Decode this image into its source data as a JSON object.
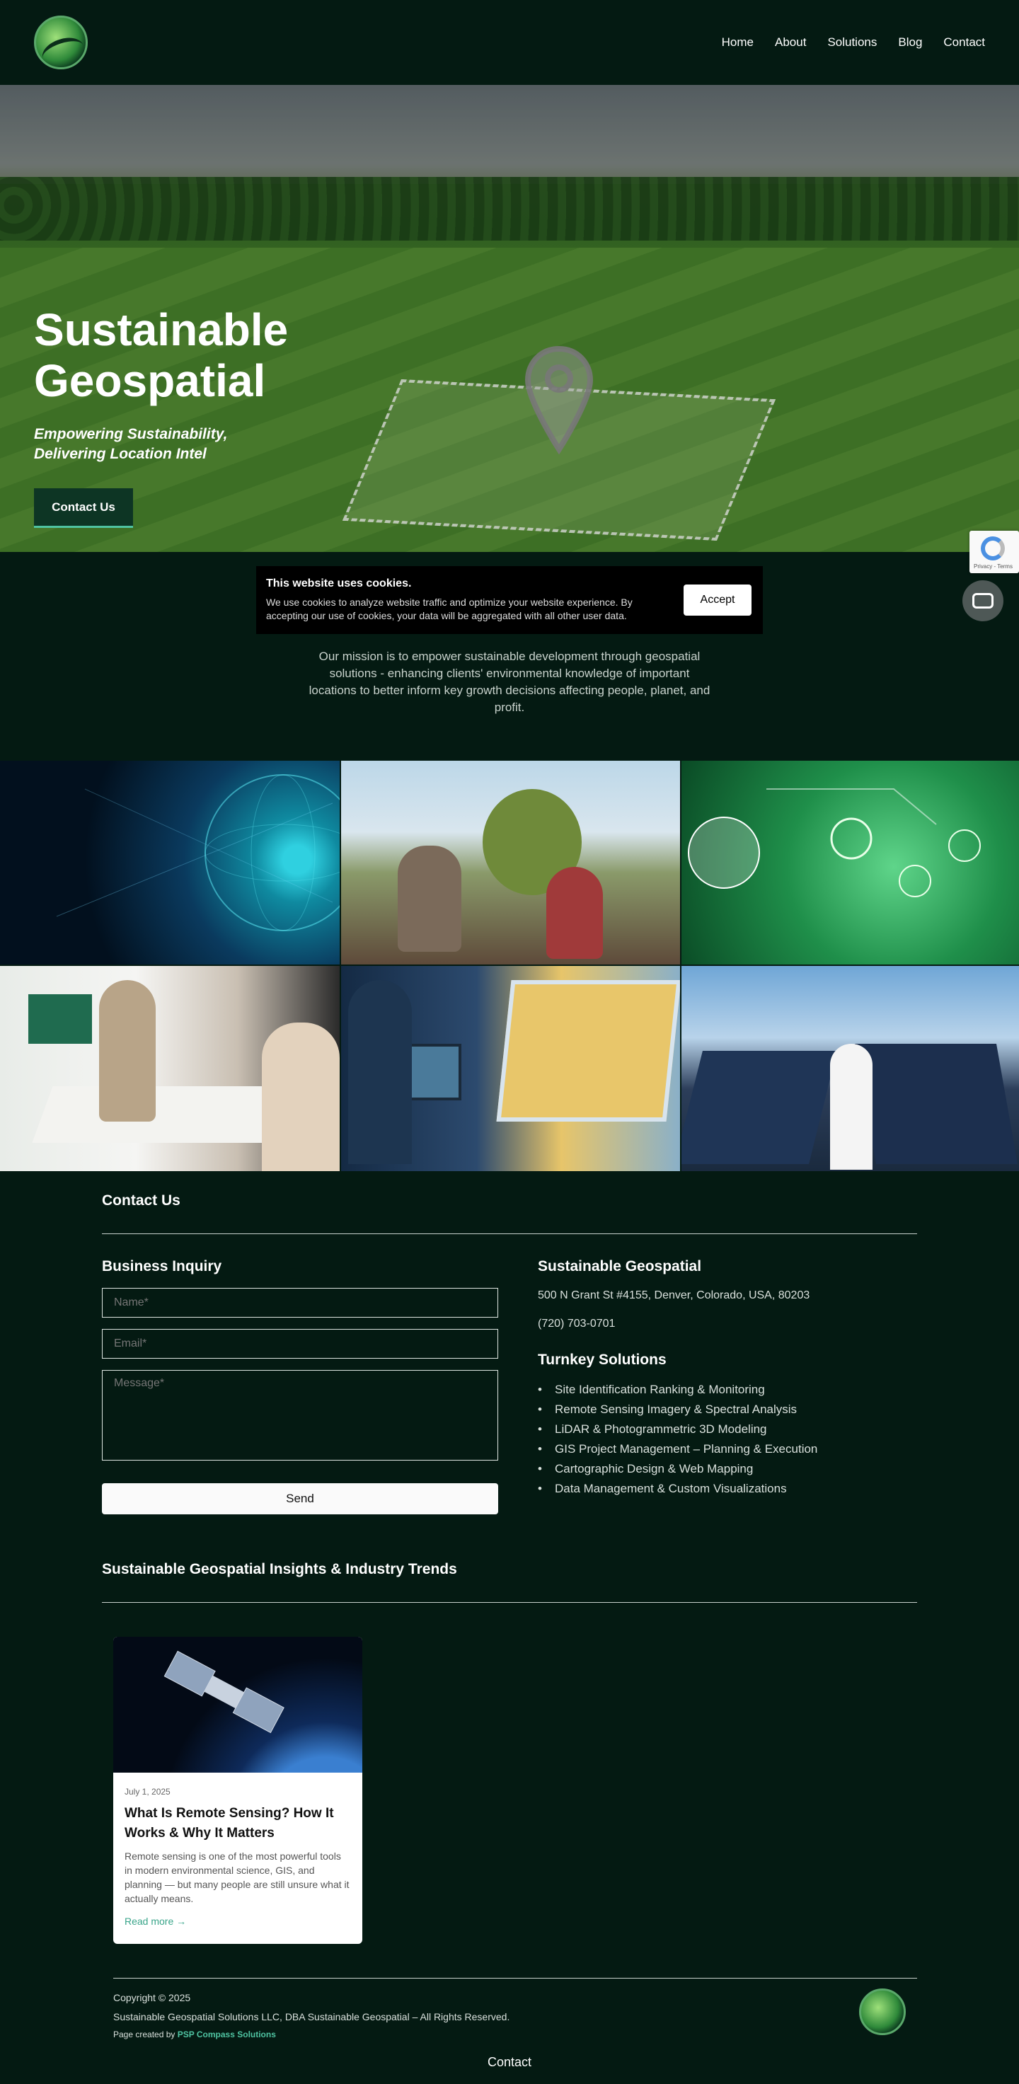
{
  "header": {
    "nav": [
      "Home",
      "About",
      "Solutions",
      "Blog",
      "Contact"
    ]
  },
  "hero": {
    "title_line1": "Sustainable",
    "title_line2": "Geospatial",
    "subtitle_line1": "Empowering Sustainability,",
    "subtitle_line2": "Delivering Location Intel",
    "cta": "Contact Us"
  },
  "cookie": {
    "title": "This website uses cookies.",
    "text": "We use cookies to analyze website traffic and optimize your website experience. By accepting our use of cookies, your data will be aggregated with all other user data.",
    "accept": "Accept"
  },
  "recaptcha": {
    "text": "Privacy - Terms"
  },
  "mission": "Our mission is to empower sustainable development through geospatial solutions - enhancing clients' environmental knowledge of important locations to better inform key growth decisions affecting people, planet, and profit.",
  "contact": {
    "heading": "Contact Us",
    "form_title": "Business Inquiry",
    "name_placeholder": "Name*",
    "email_placeholder": "Email*",
    "message_placeholder": "Message*",
    "send": "Send",
    "company": "Sustainable Geospatial",
    "address": "500 N Grant St #4155, Denver, Colorado, USA, 80203",
    "phone": "(720) 703-0701",
    "services_title": "Turnkey Solutions",
    "services": [
      "Site Identification Ranking & Monitoring",
      "Remote Sensing Imagery & Spectral Analysis",
      "LiDAR & Photogrammetric 3D Modeling",
      "GIS Project Management – Planning & Execution",
      "Cartographic Design & Web Mapping",
      "Data Management & Custom Visualizations"
    ]
  },
  "insights": {
    "heading": "Sustainable Geospatial Insights & Industry Trends",
    "card": {
      "date": "July 1, 2025",
      "title": "What Is Remote Sensing? How It Works & Why It Matters",
      "excerpt": "Remote sensing is one of the most powerful tools in modern environmental science, GIS, and planning — but many people are still unsure what it actually means.",
      "more": "Read more →"
    }
  },
  "footer": {
    "copyright": "Copyright © 2025",
    "legal": "Sustainable Geospatial Solutions LLC, DBA Sustainable Geospatial – All Rights Reserved.",
    "credit_prefix": "Page created by",
    "credit_name": "PSP Compass Solutions",
    "contact": "Contact"
  },
  "colors": {
    "background": "#041a12",
    "accent": "#4fc3a1",
    "button_dark": "#0d3524"
  }
}
